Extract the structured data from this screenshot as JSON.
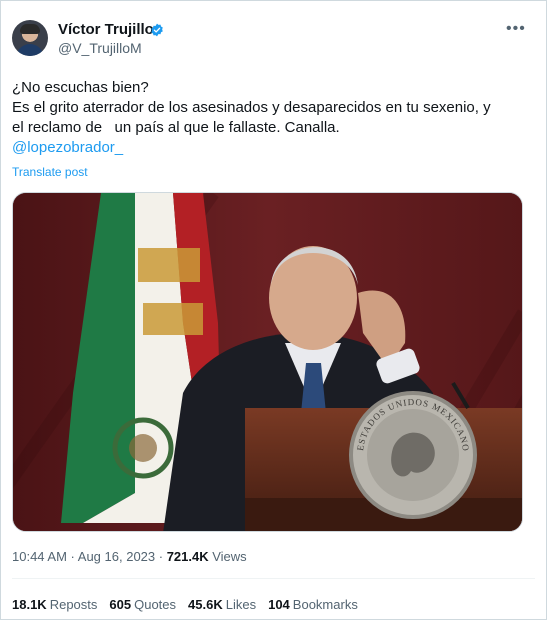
{
  "author": {
    "name": "Víctor Trujillo",
    "handle": "@V_TrujilloM"
  },
  "more_label": "•••",
  "tweet": {
    "line1": "¿No escuchas bien?",
    "line2": "Es el grito aterrador de los asesinados y desaparecidos en tu sexenio, y",
    "line3": "el reclamo de   un país al que le fallaste. Canalla.",
    "mention": "@lopezobrador_",
    "translate": "Translate post"
  },
  "media": {
    "seal_text": "ESTADOS UNIDOS MEXICANOS"
  },
  "meta": {
    "time": "10:44 AM",
    "sep1": " · ",
    "date": "Aug 16, 2023",
    "sep2": " · ",
    "views_count": "721.4K",
    "views_label": " Views"
  },
  "stats": [
    {
      "count": "18.1K",
      "label": "Reposts"
    },
    {
      "count": "605",
      "label": "Quotes"
    },
    {
      "count": "45.6K",
      "label": "Likes"
    },
    {
      "count": "104",
      "label": "Bookmarks"
    }
  ],
  "colors": {
    "accent": "#1d9bf0",
    "secondary_text": "#536471",
    "verified": "#1d9bf0"
  }
}
